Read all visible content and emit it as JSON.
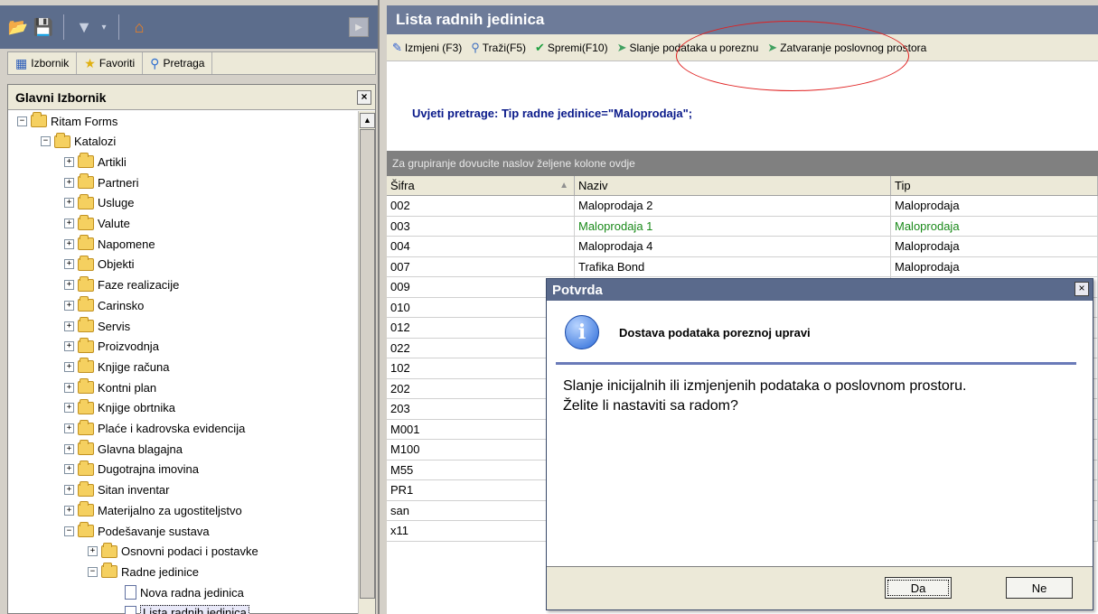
{
  "left_toolbar": {
    "icons": [
      "open-folder-icon",
      "save-icon",
      "filter-icon",
      "dropdown-icon",
      "home-icon",
      "play-icon"
    ]
  },
  "tabs": [
    {
      "label": "Izbornik",
      "icon": "menu-icon"
    },
    {
      "label": "Favoriti",
      "icon": "star-icon"
    },
    {
      "label": "Pretraga",
      "icon": "search-icon"
    }
  ],
  "menu": {
    "title": "Glavni Izbornik",
    "close_label": "×",
    "tree": [
      {
        "label": "Ritam Forms",
        "level": 0,
        "expander": "-",
        "icon": "folder"
      },
      {
        "label": "Katalozi",
        "level": 1,
        "expander": "-",
        "icon": "folder"
      },
      {
        "label": "Artikli",
        "level": 2,
        "expander": "+",
        "icon": "folder"
      },
      {
        "label": "Partneri",
        "level": 2,
        "expander": "+",
        "icon": "folder"
      },
      {
        "label": "Usluge",
        "level": 2,
        "expander": "+",
        "icon": "folder"
      },
      {
        "label": "Valute",
        "level": 2,
        "expander": "+",
        "icon": "folder"
      },
      {
        "label": "Napomene",
        "level": 2,
        "expander": "+",
        "icon": "folder"
      },
      {
        "label": "Objekti",
        "level": 2,
        "expander": "+",
        "icon": "folder"
      },
      {
        "label": "Faze realizacije",
        "level": 2,
        "expander": "+",
        "icon": "folder"
      },
      {
        "label": "Carinsko",
        "level": 2,
        "expander": "+",
        "icon": "folder"
      },
      {
        "label": "Servis",
        "level": 2,
        "expander": "+",
        "icon": "folder"
      },
      {
        "label": "Proizvodnja",
        "level": 2,
        "expander": "+",
        "icon": "folder"
      },
      {
        "label": "Knjige računa",
        "level": 2,
        "expander": "+",
        "icon": "folder"
      },
      {
        "label": "Kontni plan",
        "level": 2,
        "expander": "+",
        "icon": "folder"
      },
      {
        "label": "Knjige obrtnika",
        "level": 2,
        "expander": "+",
        "icon": "folder"
      },
      {
        "label": "Plaće i kadrovska evidencija",
        "level": 2,
        "expander": "+",
        "icon": "folder"
      },
      {
        "label": "Glavna blagajna",
        "level": 2,
        "expander": "+",
        "icon": "folder"
      },
      {
        "label": "Dugotrajna imovina",
        "level": 2,
        "expander": "+",
        "icon": "folder"
      },
      {
        "label": "Sitan inventar",
        "level": 2,
        "expander": "+",
        "icon": "folder"
      },
      {
        "label": "Materijalno za ugostiteljstvo",
        "level": 2,
        "expander": "+",
        "icon": "folder"
      },
      {
        "label": "Podešavanje sustava",
        "level": 2,
        "expander": "-",
        "icon": "folder"
      },
      {
        "label": "Osnovni podaci i postavke",
        "level": 3,
        "expander": "+",
        "icon": "folder"
      },
      {
        "label": "Radne jedinice",
        "level": 3,
        "expander": "-",
        "icon": "folder"
      },
      {
        "label": "Nova radna jedinica",
        "level": 4,
        "expander": "",
        "icon": "doc"
      },
      {
        "label": "Lista radnih jedinica",
        "level": 4,
        "expander": "",
        "icon": "doc",
        "selected": true
      }
    ]
  },
  "window": {
    "title": "Lista radnih jedinica"
  },
  "toolbar": {
    "izmjeni": "Izmjeni (F3)",
    "trazi": "Traži(F5)",
    "spremi": "Spremi(F10)",
    "slanje": "Slanje podataka u poreznu",
    "zatvaranje": "Zatvaranje poslovnog prostora"
  },
  "criteria": "Uvjeti pretrage: Tip radne jedinice=\"Maloprodaja\";",
  "group_hint": "Za grupiranje dovucite naslov željene kolone ovdje",
  "grid": {
    "columns": [
      "Šifra",
      "Naziv",
      "Tip"
    ],
    "rows": [
      {
        "sifra": "002",
        "naziv": "Maloprodaja 2",
        "tip": "Maloprodaja"
      },
      {
        "sifra": "003",
        "naziv": "Maloprodaja 1",
        "tip": "Maloprodaja",
        "highlight": true
      },
      {
        "sifra": "004",
        "naziv": "Maloprodaja 4",
        "tip": "Maloprodaja"
      },
      {
        "sifra": "007",
        "naziv": "Trafika Bond",
        "tip": "Maloprodaja"
      },
      {
        "sifra": "009",
        "naziv": "",
        "tip": ""
      },
      {
        "sifra": "010",
        "naziv": "",
        "tip": ""
      },
      {
        "sifra": "012",
        "naziv": "",
        "tip": ""
      },
      {
        "sifra": "022",
        "naziv": "",
        "tip": ""
      },
      {
        "sifra": "102",
        "naziv": "",
        "tip": ""
      },
      {
        "sifra": "202",
        "naziv": "",
        "tip": ""
      },
      {
        "sifra": "203",
        "naziv": "",
        "tip": ""
      },
      {
        "sifra": "M001",
        "naziv": "",
        "tip": ""
      },
      {
        "sifra": "M100",
        "naziv": "",
        "tip": ""
      },
      {
        "sifra": "M55",
        "naziv": "",
        "tip": ""
      },
      {
        "sifra": "PR1",
        "naziv": "",
        "tip": ""
      },
      {
        "sifra": "san",
        "naziv": "",
        "tip": ""
      },
      {
        "sifra": "x11",
        "naziv": "",
        "tip": ""
      }
    ]
  },
  "dialog": {
    "title": "Potvrda",
    "close_label": "×",
    "heading": "Dostava podataka poreznoj upravi",
    "message_line1": "Slanje inicijalnih ili izmjenjenih podataka o poslovnom prostoru.",
    "message_line2": "Želite li nastaviti sa radom?",
    "yes": "Da",
    "no": "Ne"
  },
  "colors": {
    "title_bar": "#6d7b99",
    "criteria_text": "#0a1a8a",
    "highlight_row_text": "#1a8a1a",
    "annotation": "#e02020"
  }
}
